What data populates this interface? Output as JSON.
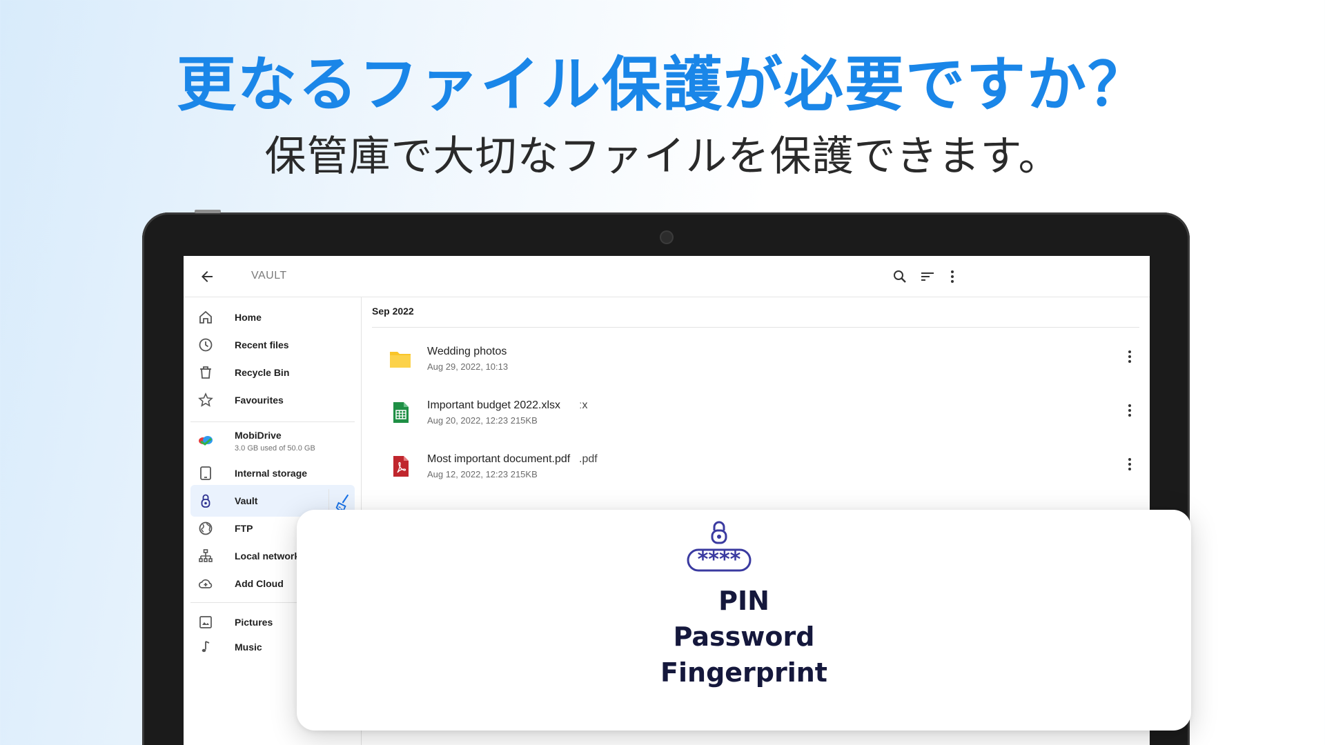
{
  "headline": "更なるファイル保護が必要ですか？",
  "subline": "保管庫で大切なファイルを保護できます。",
  "appbar": {
    "title": "VAULT",
    "back_icon": "arrow-left-icon",
    "actions": [
      "search-icon",
      "sort-icon",
      "more-vert-icon"
    ]
  },
  "sidebar": {
    "items": [
      {
        "label": "Home",
        "icon": "home-icon"
      },
      {
        "label": "Recent files",
        "icon": "clock-icon"
      },
      {
        "label": "Recycle Bin",
        "icon": "trash-icon"
      },
      {
        "label": "Favourites",
        "icon": "star-icon"
      },
      {
        "label": "MobiDrive",
        "sub": "3.0 GB used of 50.0 GB",
        "icon": "mobidrive-icon"
      },
      {
        "label": "Internal storage",
        "icon": "tablet-icon"
      },
      {
        "label": "Vault",
        "icon": "vault-lock-icon",
        "active": true
      },
      {
        "label": "FTP",
        "icon": "globe-icon"
      },
      {
        "label": "Local network",
        "icon": "network-icon"
      },
      {
        "label": "Add Cloud",
        "icon": "cloud-add-icon"
      },
      {
        "label": "Pictures",
        "icon": "image-icon"
      },
      {
        "label": "Music",
        "icon": "music-note-icon"
      }
    ]
  },
  "content": {
    "section": "Sep 2022",
    "files": [
      {
        "name": "Wedding photos",
        "meta": "Aug 29, 2022, 10:13",
        "ghost": "",
        "type": "folder"
      },
      {
        "name": "Important budget 2022.xlsx",
        "meta": "Aug 20, 2022, 12:23  215KB",
        "ghost": "ːx",
        "type": "sheet"
      },
      {
        "name": "Most important document.pdf",
        "meta": "Aug 12, 2022, 12:23  215KB",
        "ghost": ".pdf",
        "type": "pdf"
      }
    ]
  },
  "card": {
    "pin_mask": "****",
    "lines": [
      "PIN",
      "Password",
      "Fingerprint"
    ]
  },
  "colors": {
    "headline": "#1a86e8",
    "accent_blue": "#1a73e8",
    "folder": "#f9c52a",
    "sheet": "#1f8f45",
    "pdf": "#c0262d",
    "card_ink": "#15183c",
    "lock_ink": "#3a3aa0"
  }
}
